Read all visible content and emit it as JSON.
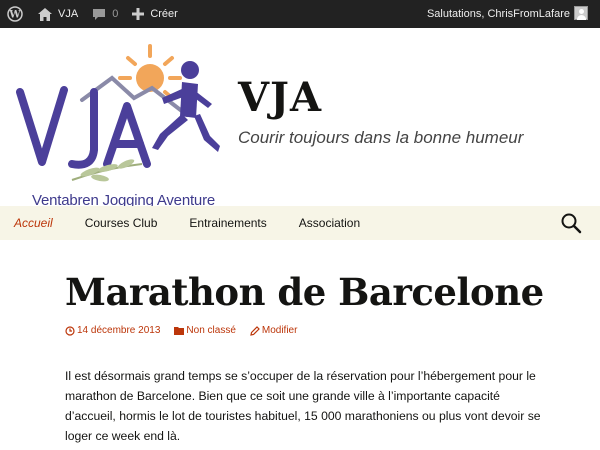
{
  "adminbar": {
    "site_name": "VJA",
    "comments_count": "0",
    "new_label": "Créer",
    "greeting": "Salutations, ChrisFromLafare"
  },
  "header": {
    "logo_text": "Ventabren Jogging Aventure",
    "site_title": "VJA",
    "site_description": "Courir toujours dans la bonne humeur"
  },
  "nav": {
    "items": [
      {
        "label": "Accueil"
      },
      {
        "label": "Courses Club"
      },
      {
        "label": "Entrainements"
      },
      {
        "label": "Association"
      }
    ]
  },
  "post": {
    "title": "Marathon de Barcelone",
    "date": "14 décembre 2013",
    "category": "Non classé",
    "edit": "Modifier",
    "body": "Il est désormais grand temps se s’occuper de la réservation pour l’hébergement pour le marathon de Barcelone. Bien que ce soit une grande ville à l’importante capacité d’accueil, hormis le lot de touristes habituel, 15 000 marathoniens ou plus vont devoir se loger ce week end là."
  },
  "colors": {
    "accent": "#bc360a",
    "nav_bg": "#f7f5e7",
    "adminbar_bg": "#222222"
  }
}
